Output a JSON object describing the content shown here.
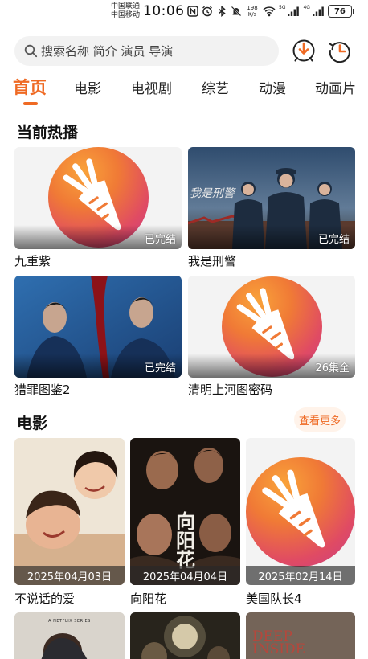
{
  "status_bar": {
    "carrier_1": "中国联通",
    "carrier_2": "中国移动",
    "time": "10:06",
    "net_speed_value": "198",
    "net_speed_unit": "K/s",
    "signal_1_label": "5G",
    "signal_2_label": "4G",
    "battery": "76"
  },
  "search": {
    "placeholder": "搜索名称 简介 演员 导演"
  },
  "tabs": [
    {
      "label": "首页",
      "active": true
    },
    {
      "label": "电影"
    },
    {
      "label": "电视剧"
    },
    {
      "label": "综艺"
    },
    {
      "label": "动漫"
    },
    {
      "label": "动画片"
    }
  ],
  "sections": {
    "now_playing": {
      "title": "当前热播",
      "items": [
        {
          "title": "九重紫",
          "badge": "已完结",
          "art": "placeholder-logo"
        },
        {
          "title": "我是刑警",
          "badge": "已完结",
          "art": "police-poster",
          "poster_text": "我是刑警"
        },
        {
          "title": "猎罪图鉴2",
          "badge": "已完结",
          "art": "detective-poster"
        },
        {
          "title": "清明上河图密码",
          "badge": "26集全",
          "art": "placeholder-logo"
        }
      ]
    },
    "movies": {
      "title": "电影",
      "more_label": "查看更多",
      "items": [
        {
          "title": "不说话的爱",
          "date": "2025年04月03日",
          "art": "bright-poster"
        },
        {
          "title": "向阳花",
          "date": "2025年04月04日",
          "art": "dark-poster",
          "poster_text": "向阳花"
        },
        {
          "title": "美国队长4",
          "date": "2025年02月14日",
          "art": "placeholder-logo"
        }
      ],
      "next_row": [
        {
          "art": "netflix-poster",
          "poster_text": "A NETFLIX SERIES"
        },
        {
          "art": "night-poster"
        },
        {
          "art": "deep-inside-poster",
          "poster_text": "DEEP INSIDE"
        }
      ]
    }
  },
  "colors": {
    "accent": "#ef6a24",
    "logo_gradient": [
      "#f9a33a",
      "#e04b63",
      "#c73e86"
    ]
  }
}
